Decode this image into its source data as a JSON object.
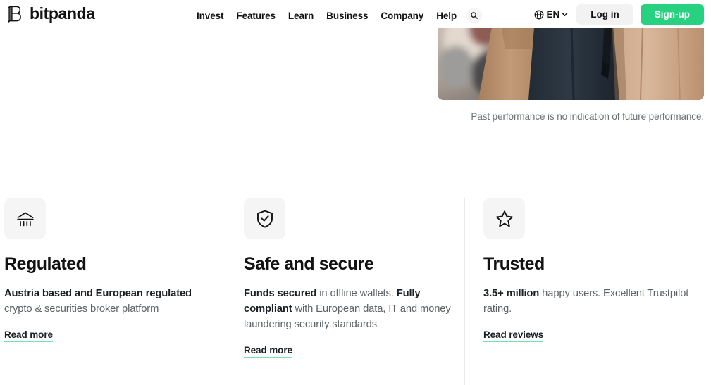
{
  "header": {
    "brand": {
      "name": "bitpanda",
      "logo_icon": "bitpanda-b-logo"
    },
    "nav_items": [
      {
        "label": "Invest"
      },
      {
        "label": "Features"
      },
      {
        "label": "Learn"
      },
      {
        "label": "Business"
      },
      {
        "label": "Company"
      },
      {
        "label": "Help"
      }
    ],
    "search_icon": "search-icon",
    "language": {
      "icon": "globe-icon",
      "label": "EN",
      "chevron": "chevron-down-icon"
    },
    "login_label": "Log in",
    "signup_label": "Sign-up"
  },
  "hero": {
    "photo_alt": "person-in-beige-coat-and-dark-trousers",
    "disclaimer": "Past performance is no indication of future performance."
  },
  "features": [
    {
      "icon": "bank-icon",
      "title": "Regulated",
      "body_parts": [
        {
          "text": "Austria based and European regulated",
          "bold": true
        },
        {
          "text": " crypto & securities broker platform",
          "bold": false
        }
      ],
      "link_label": "Read more"
    },
    {
      "icon": "shield-check-icon",
      "title": "Safe and secure",
      "body_parts": [
        {
          "text": "Funds secured",
          "bold": true
        },
        {
          "text": " in offline wallets. ",
          "bold": false
        },
        {
          "text": "Fully compliant",
          "bold": true
        },
        {
          "text": " with European data, IT and money laundering security standards",
          "bold": false
        }
      ],
      "link_label": "Read more"
    },
    {
      "icon": "star-icon",
      "title": "Trusted",
      "body_parts": [
        {
          "text": "3.5+ million",
          "bold": true
        },
        {
          "text": " happy users. Excellent Trustpilot rating.",
          "bold": false
        }
      ],
      "link_label": "Read reviews"
    }
  ],
  "colors": {
    "accent_green": "#27d17f",
    "link_underline": "#76e3ae",
    "text_dark": "#121212",
    "text_muted": "#5d6368",
    "tile_bg": "#f5f5f5",
    "divider": "#e9eaec"
  }
}
